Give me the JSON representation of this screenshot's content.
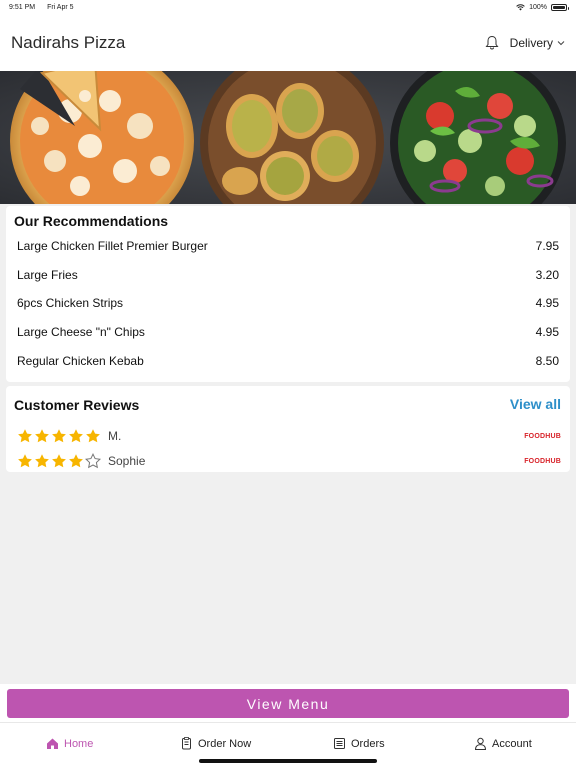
{
  "status_bar": {
    "time": "9:51 PM",
    "date": "Fri Apr 5",
    "battery": "100%",
    "battery_level": 1.0
  },
  "header": {
    "restaurant_name": "Nadirahs Pizza",
    "notification_icon": "bell-icon",
    "delivery_label": "Delivery",
    "delivery_icon": "chevron-down-icon"
  },
  "recommendations": {
    "title": "Our Recommendations",
    "items": [
      {
        "name": "Large Chicken Fillet Premier Burger",
        "price": "7.95"
      },
      {
        "name": "Large Fries",
        "price": "3.20"
      },
      {
        "name": "6pcs Chicken Strips",
        "price": "4.95"
      },
      {
        "name": "Large Cheese \"n\" Chips",
        "price": "4.95"
      },
      {
        "name": "Regular Chicken Kebab",
        "price": "8.50"
      }
    ]
  },
  "reviews": {
    "title": "Customer Reviews",
    "view_all": "View all",
    "items": [
      {
        "reviewer": "M.",
        "rating": 5,
        "source": "FOODHUB"
      },
      {
        "reviewer": "Sophie",
        "rating": 4,
        "source": "FOODHUB"
      }
    ]
  },
  "view_menu": {
    "label": "View Menu"
  },
  "tabbar": {
    "tabs": [
      {
        "label": "Home",
        "icon": "home-icon",
        "active": true
      },
      {
        "label": "Order Now",
        "icon": "order-icon",
        "active": false
      },
      {
        "label": "Orders",
        "icon": "receipt-icon",
        "active": false
      },
      {
        "label": "Account",
        "icon": "user-icon",
        "active": false
      }
    ]
  },
  "colors": {
    "accent": "#bd55b0",
    "link": "#2d8fc9",
    "star": "#f7b500",
    "foodhub": "#d8232a"
  }
}
